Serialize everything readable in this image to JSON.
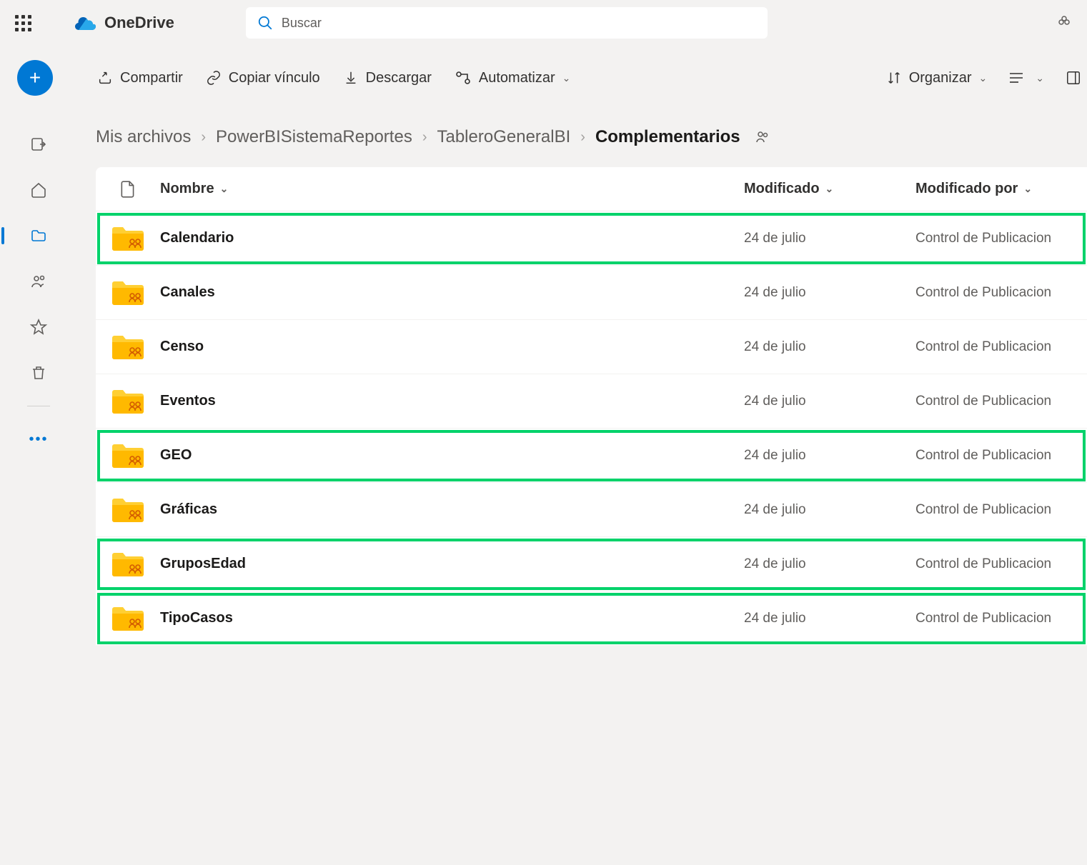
{
  "app": {
    "name": "OneDrive"
  },
  "search": {
    "placeholder": "Buscar"
  },
  "toolbar": {
    "share": "Compartir",
    "copy_link": "Copiar vínculo",
    "download": "Descargar",
    "automate": "Automatizar",
    "organize": "Organizar"
  },
  "breadcrumb": {
    "items": [
      "Mis archivos",
      "PowerBISistemaReportes",
      "TableroGeneralBI"
    ],
    "current": "Complementarios"
  },
  "columns": {
    "name": "Nombre",
    "modified": "Modificado",
    "modified_by": "Modificado por"
  },
  "rows": [
    {
      "name": "Calendario",
      "modified": "24 de julio",
      "modified_by": "Control de Publicacion",
      "highlight": true
    },
    {
      "name": "Canales",
      "modified": "24 de julio",
      "modified_by": "Control de Publicacion",
      "highlight": false
    },
    {
      "name": "Censo",
      "modified": "24 de julio",
      "modified_by": "Control de Publicacion",
      "highlight": false
    },
    {
      "name": "Eventos",
      "modified": "24 de julio",
      "modified_by": "Control de Publicacion",
      "highlight": false
    },
    {
      "name": "GEO",
      "modified": "24 de julio",
      "modified_by": "Control de Publicacion",
      "highlight": true
    },
    {
      "name": "Gráficas",
      "modified": "24 de julio",
      "modified_by": "Control de Publicacion",
      "highlight": false
    },
    {
      "name": "GruposEdad",
      "modified": "24 de julio",
      "modified_by": "Control de Publicacion",
      "highlight": true
    },
    {
      "name": "TipoCasos",
      "modified": "24 de julio",
      "modified_by": "Control de Publicacion",
      "highlight": true
    }
  ]
}
